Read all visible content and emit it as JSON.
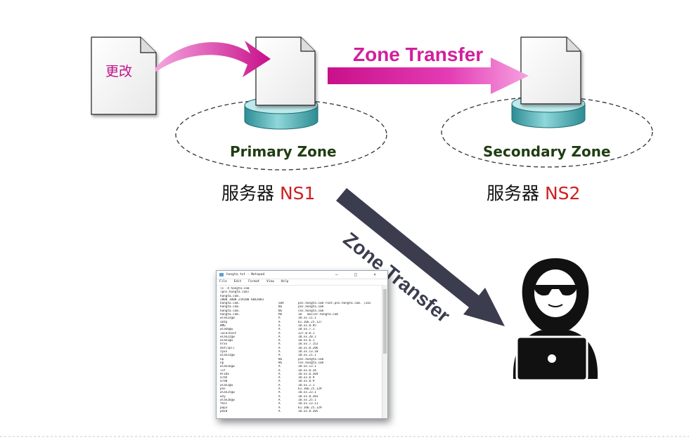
{
  "change_doc": {
    "label": "更改"
  },
  "zone_transfer_top": {
    "label": "Zone Transfer",
    "color": "#d21f9c"
  },
  "zone_transfer_attack": {
    "label": "Zone Transfer",
    "color": "#3b3d4e"
  },
  "primary": {
    "zone_label": "Primary Zone",
    "server_prefix": "服务器",
    "server_name": "NS1"
  },
  "secondary": {
    "zone_label": "Secondary Zone",
    "server_prefix": "服务器",
    "server_name": "NS2"
  },
  "notepad": {
    "title": "hongta.txt - Notepad",
    "window_buttons": "– □ ×",
    "menu": [
      "File",
      "Edit",
      "Format",
      "View",
      "Help"
    ],
    "header_lines": [
      "ls -d hongta.com",
      "[pns.hongta.com]",
      "hongta.com.",
      "2000 1800 259200 6042003"
    ],
    "records": [
      [
        "hongta.com.",
        "SOA",
        "pns.hongta.com root.pns.hongta.com. (242"
      ],
      [
        "hongta.com.",
        "NS",
        "pns.hongta.com"
      ],
      [
        "hongta.com.",
        "NS",
        "sns.hongta.com"
      ],
      [
        "hongta.com.",
        "MX",
        "10   mailer.hongta.com"
      ],
      [
        "wlan22gw",
        "A",
        "10.xx.11.1"
      ],
      [
        "smtp",
        "A",
        "61.166.25.127"
      ],
      [
        "HMG",
        "A",
        "10.xx.0.95"
      ],
      [
        "wlan6gw",
        "A",
        "10.xx.7.1"
      ],
      [
        "localhost",
        "A",
        "127.0.0.1"
      ],
      [
        "wlan22gw",
        "A",
        "10.xx.20.1"
      ],
      [
        "wlan1gw",
        "A",
        "10.xx.6.1"
      ],
      [
        "hrxx",
        "A",
        "10.xx.7.152"
      ],
      [
        "dotlvpll",
        "A",
        "10.xx.0.206"
      ],
      [
        "zyxx",
        "A",
        "10.xx.13.10"
      ],
      [
        "wlan23gw",
        "A",
        "10.xx.21.1"
      ],
      [
        "np",
        "NS",
        "pns.hongta.com"
      ],
      [
        "np",
        "NS",
        "sns.hongta.com"
      ],
      [
        "wlan16gw",
        "A",
        "10.xx.13.1"
      ],
      [
        "lsf",
        "A",
        "10.xx.0.34"
      ],
      [
        "HTIDS",
        "A",
        "10.xx.0.204"
      ],
      [
        "a7ah",
        "A",
        "10.xx.0.9"
      ],
      [
        "a7a8",
        "A",
        "10.xx.0.9"
      ],
      [
        "wlan2gw",
        "A",
        "10.xx.2.1"
      ],
      [
        "pns",
        "A",
        "61.166.25.129"
      ],
      [
        "wlan25gw",
        "A",
        "10.xx.23.1"
      ],
      [
        "wzy",
        "A",
        "10.xx.0.203"
      ],
      [
        "wlan26gw",
        "A",
        "10.xx.25.1"
      ],
      [
        "fksc",
        "A",
        "10.xx.13.11"
      ],
      [
        "pop3",
        "A",
        "61.166.25.129"
      ],
      [
        "pd10",
        "A",
        "10.xx.0.205"
      ]
    ]
  }
}
